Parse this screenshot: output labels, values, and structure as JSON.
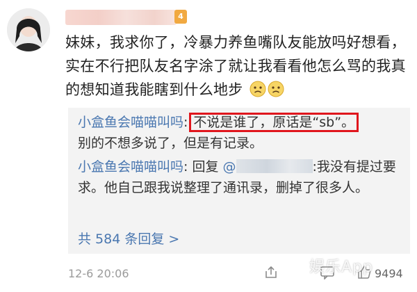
{
  "post": {
    "user_badge": "4",
    "comment_text": "妹妹，我求你了，冷暴力养鱼嘴队友能放吗好想看，实在不行把队友名字涂了就让我看看他怎么骂的我真的想知道我能瞎到什么地步",
    "emoji": [
      "sad-face-icon",
      "sad-face-icon"
    ]
  },
  "replies": [
    {
      "author": "小盒鱼会喵喵叫吗",
      "separator": ":",
      "highlighted_text": "不说是谁了，原话是“sb”。",
      "text": "别的不想多说了，但是有记录。"
    },
    {
      "author": "小盒鱼会喵喵叫吗",
      "separator": ": ",
      "reply_prefix": "回复",
      "mention_at": "@",
      "text_after_mention": ":我没有提过要求。他自己跟我说整理了通讯录，删掉了很多人。"
    }
  ],
  "more_replies": "共 584 条回复 >",
  "footer": {
    "timestamp": "12-6 20:06",
    "like_count": "9494"
  },
  "watermark": "娱乐App",
  "colors": {
    "link": "#4a77b0",
    "highlight_border": "#e0161d",
    "reply_bg": "#f3f3f3",
    "meta": "#9b9b9b"
  }
}
